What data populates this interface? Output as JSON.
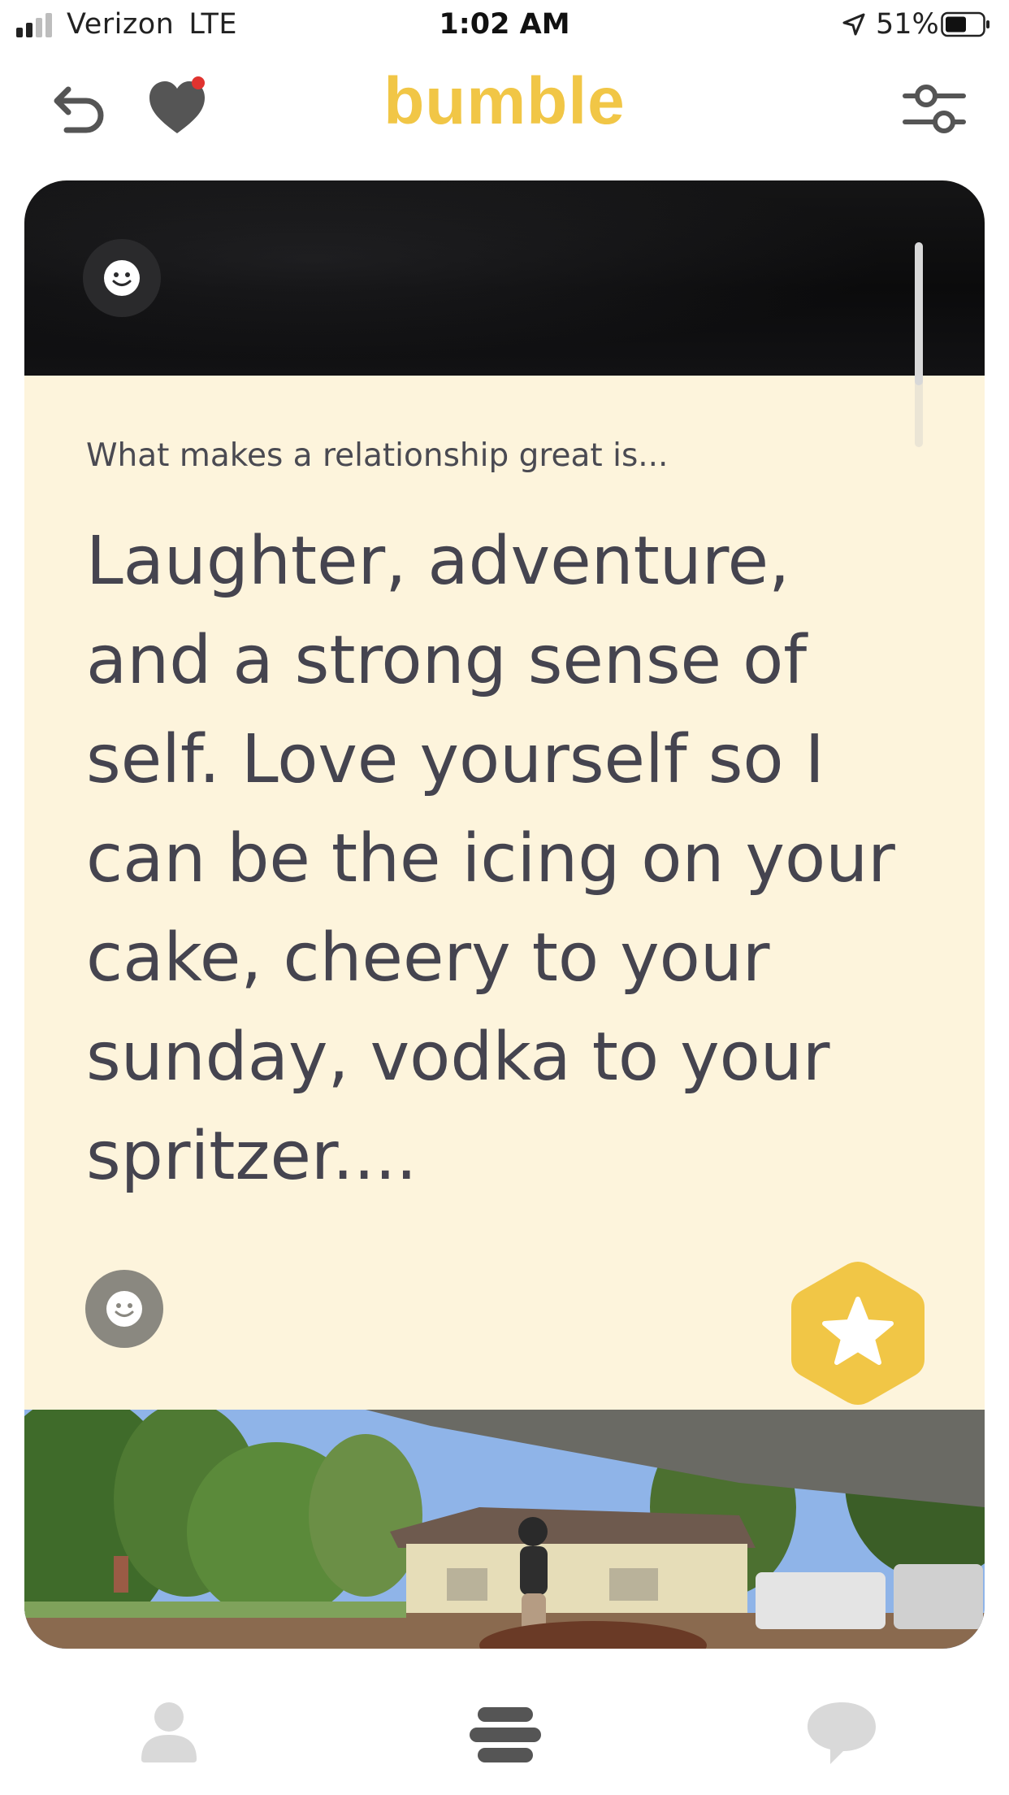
{
  "status_bar": {
    "carrier": "Verizon",
    "network": "LTE",
    "time": "1:02 AM",
    "battery_percent": "51%",
    "signal_bars": 2,
    "icons": [
      "signal-icon",
      "location-arrow-icon",
      "battery-icon"
    ]
  },
  "header": {
    "logo_text": "bumble",
    "left_icons": [
      "undo-icon",
      "heart-icon"
    ],
    "right_icons": [
      "filter-sliders-icon"
    ],
    "notification_dot": true
  },
  "card": {
    "prompt_question": "What makes a relationship great is...",
    "prompt_answer": "Laughter, adventure, and a strong sense of self. Love yourself so I can be the icing on your cake, cheery to your sunday, vodka to your spritzer....",
    "icons": [
      "smiley-icon",
      "superswipe-star-icon"
    ],
    "scroll_progress": 0.7
  },
  "bottom_nav": {
    "items": [
      "profile-icon",
      "stack-icon",
      "chat-icon"
    ],
    "active": "stack-icon"
  },
  "colors": {
    "brand_yellow": "#f1c646",
    "card_background": "#fdf4dc",
    "text_dark": "#45444f",
    "notification_red": "#e0332f",
    "icon_gray": "#555555",
    "nav_inactive": "#d9d9d9",
    "nav_active": "#555555"
  }
}
